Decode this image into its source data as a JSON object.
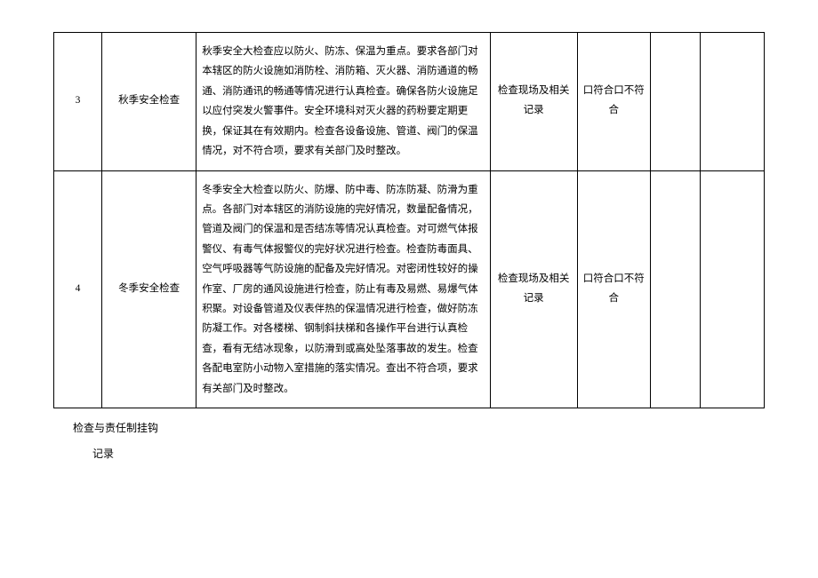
{
  "table": {
    "rows": [
      {
        "num": "3",
        "name": "秋季安全检查",
        "desc": "秋季安全大检查应以防火、防冻、保温为重点。要求各部门对本辖区的防火设施如消防栓、消防箱、灭火器、消防通道的畅通、消防通讯的畅通等情况进行认真检查。确保各防火设施足以应付突发火警事件。安全环境科对灭火器的药粉要定期更换，保证其在有效期内。检查各设备设施、管道、阀门的保温情况，对不符合项，要求有关部门及时整改。",
        "scope": "检查现场及相关记录",
        "result": "口符合口不符合",
        "blank1": "",
        "blank2": ""
      },
      {
        "num": "4",
        "name": "冬季安全检查",
        "desc": "冬季安全大检查以防火、防爆、防中毒、防冻防凝、防滑为重点。各部门对本辖区的消防设施的完好情况，数量配备情况，管道及阀门的保温和是否结冻等情况认真检查。对可燃气体报警仪、有毒气体报警仪的完好状况进行检查。检查防毒面具、空气呼吸器等气防设施的配备及完好情况。对密闭性较好的操作室、厂房的通风设施进行检查，防止有毒及易燃、易爆气体积聚。对设备管道及仪表伴热的保温情况进行检查，做好防冻防凝工作。对各楼梯、钢制斜扶梯和各操作平台进行认真检查，看有无结冰现象，以防滑到或高处坠落事故的发生。检查各配电室防小动物入室措施的落实情况。查出不符合项，要求有关部门及时整改。",
        "scope": "检查现场及相关记录",
        "result": "口符合口不符合",
        "blank1": "",
        "blank2": ""
      }
    ]
  },
  "notes": {
    "line1": "检查与责任制挂钩",
    "line2": "记录"
  }
}
